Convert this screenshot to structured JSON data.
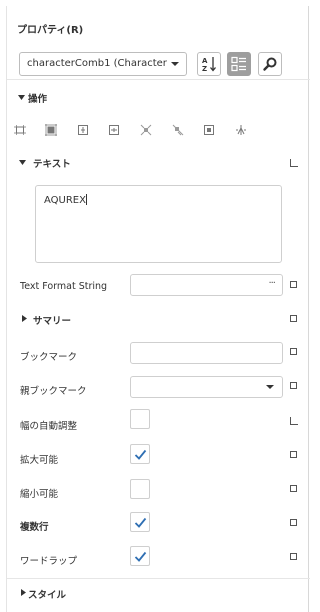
{
  "panel": {
    "title": "プロパティ(R)",
    "object_selector": {
      "value": "characterComb1 (Character C..."
    },
    "toolbar": [
      "sort-alphabetical-icon",
      "categorized-view-icon",
      "search-icon"
    ]
  },
  "sections": {
    "operations": {
      "label": "操作",
      "expanded": true
    },
    "text": {
      "label": "テキスト",
      "expanded": true,
      "value": "AQUREX"
    },
    "summary": {
      "label": "サマリー",
      "expanded": false
    },
    "style": {
      "label": "スタイル",
      "expanded": false
    }
  },
  "layout_tools": [
    "align-to-grid-icon",
    "size-to-grid-icon",
    "center-horizontally-icon",
    "center-vertically-icon",
    "bring-to-front-icon",
    "send-to-back-icon",
    "fit-to-container-icon",
    "anchor-icon"
  ],
  "props": {
    "text_format_string": {
      "label": "Text Format String",
      "value": "",
      "button": "···"
    },
    "bookmark": {
      "label": "ブックマーク",
      "value": ""
    },
    "parent_bookmark": {
      "label": "親ブックマーク",
      "value": ""
    },
    "auto_width": {
      "label": "幅の自動調整",
      "checked": false
    },
    "can_grow": {
      "label": "拡大可能",
      "checked": true
    },
    "can_shrink": {
      "label": "縮小可能",
      "checked": false
    },
    "multiline": {
      "label": "複数行",
      "checked": true
    },
    "word_wrap": {
      "label": "ワードラップ",
      "checked": true
    }
  },
  "colors": {
    "accent": "#2f6fb3",
    "border": "#cfcfcf",
    "active_button": "#9e9e9e"
  }
}
